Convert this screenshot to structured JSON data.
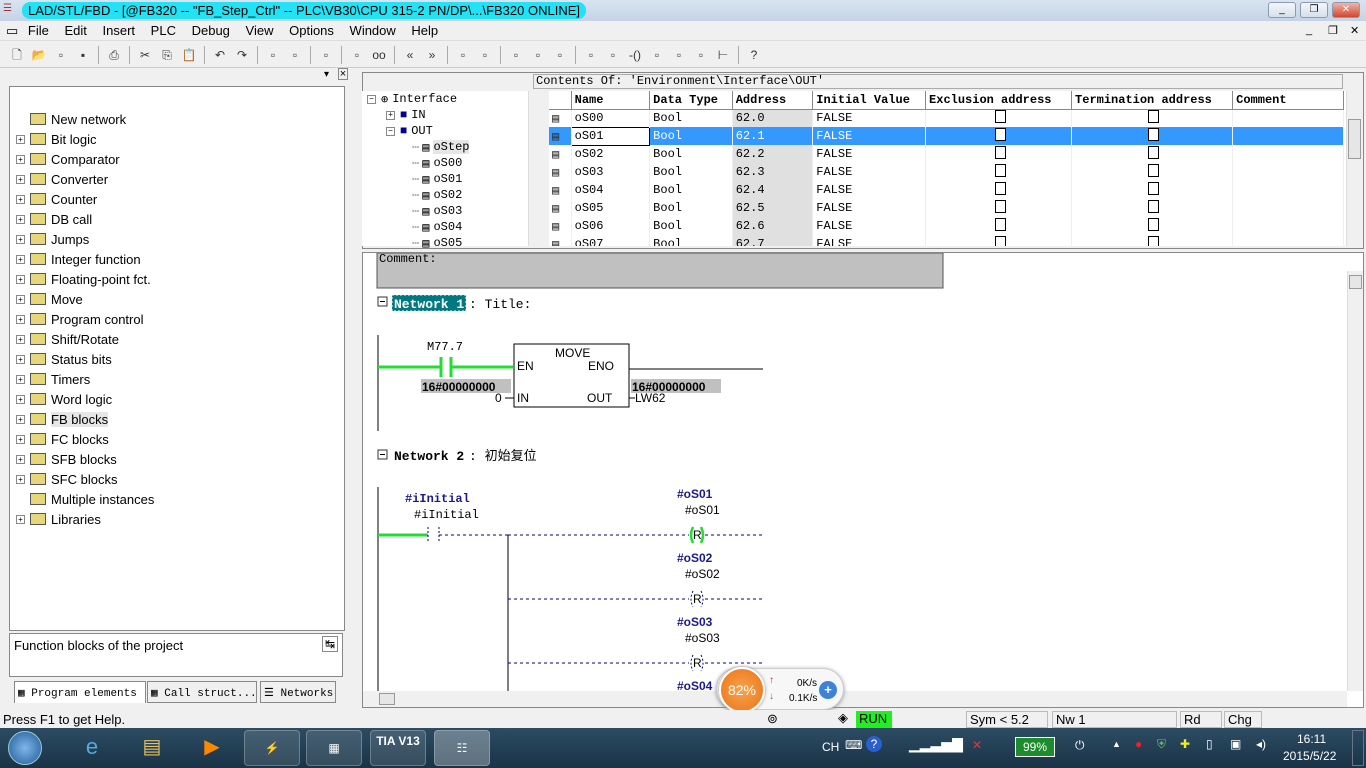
{
  "window": {
    "title": "LAD/STL/FBD  - [@FB320 -- \"FB_Step_Ctrl\" -- PLC\\VB30\\CPU 315-2 PN/DP\\...\\FB320  ONLINE]",
    "controls": [
      "minimize",
      "restore",
      "close"
    ]
  },
  "menu": [
    "File",
    "Edit",
    "Insert",
    "PLC",
    "Debug",
    "View",
    "Options",
    "Window",
    "Help"
  ],
  "toolbar_icons": [
    "new-icon",
    "open-icon",
    "accessible-nodes-icon",
    "save-icon",
    "print-icon",
    "cut-icon",
    "copy-icon",
    "paste-icon",
    "undo-icon",
    "redo-icon",
    "download-icon",
    "upload-icon",
    "monitor-icon",
    "network-icon",
    "glasses-icon",
    "prev-icon",
    "next-icon",
    "overview-icon",
    "details-icon",
    "new-network-icon",
    "branch-icon",
    "close-branch-icon",
    "no-contact-icon",
    "nc-contact-icon",
    "coil-icon",
    "empty-box-icon",
    "open-branch-icon",
    "close-branch-arrow-icon",
    "connect-icon",
    "help-icon"
  ],
  "left": {
    "items": [
      {
        "label": "New network",
        "icon": "new-network-icon",
        "expand": false
      },
      {
        "label": "Bit logic",
        "icon": "bit-logic-icon",
        "expand": true
      },
      {
        "label": "Comparator",
        "icon": "comparator-icon",
        "expand": true
      },
      {
        "label": "Converter",
        "icon": "converter-icon",
        "expand": true
      },
      {
        "label": "Counter",
        "icon": "counter-icon",
        "expand": true
      },
      {
        "label": "DB call",
        "icon": "db-call-icon",
        "expand": true
      },
      {
        "label": "Jumps",
        "icon": "jumps-icon",
        "expand": true
      },
      {
        "label": "Integer function",
        "icon": "integer-icon",
        "expand": true
      },
      {
        "label": "Floating-point fct.",
        "icon": "float-icon",
        "expand": true
      },
      {
        "label": "Move",
        "icon": "move-icon",
        "expand": true
      },
      {
        "label": "Program control",
        "icon": "program-control-icon",
        "expand": true
      },
      {
        "label": "Shift/Rotate",
        "icon": "shift-icon",
        "expand": true
      },
      {
        "label": "Status bits",
        "icon": "status-bits-icon",
        "expand": true
      },
      {
        "label": "Timers",
        "icon": "timers-icon",
        "expand": true
      },
      {
        "label": "Word logic",
        "icon": "word-logic-icon",
        "expand": true
      },
      {
        "label": "FB blocks",
        "icon": "fb-blocks-icon",
        "expand": true,
        "selected": true
      },
      {
        "label": "FC blocks",
        "icon": "fc-blocks-icon",
        "expand": true
      },
      {
        "label": "SFB blocks",
        "icon": "sfb-blocks-icon",
        "expand": true
      },
      {
        "label": "SFC blocks",
        "icon": "sfc-blocks-icon",
        "expand": true
      },
      {
        "label": "Multiple instances",
        "icon": "multi-instance-icon",
        "expand": false
      },
      {
        "label": "Libraries",
        "icon": "libraries-icon",
        "expand": true
      }
    ],
    "info": "Function blocks of the project",
    "tabs": [
      "Program elements",
      "Call struct...",
      "Networks"
    ]
  },
  "interface": {
    "contents": "Contents Of: 'Environment\\Interface\\OUT'",
    "tree": {
      "root": "Interface",
      "in": "IN",
      "out": "OUT",
      "children": [
        "oStep",
        "oS00",
        "oS01",
        "oS02",
        "oS03",
        "oS04",
        "oS05"
      ]
    },
    "columns": [
      "Name",
      "Data Type",
      "Address",
      "Initial Value",
      "Exclusion address",
      "Termination address",
      "Comment"
    ],
    "rows": [
      {
        "name": "oS00",
        "type": "Bool",
        "address": "62.0",
        "initial": "FALSE",
        "exclusion": false,
        "termination": false
      },
      {
        "name": "oS01",
        "type": "Bool",
        "address": "62.1",
        "initial": "FALSE",
        "exclusion": false,
        "termination": false,
        "selected": true
      },
      {
        "name": "oS02",
        "type": "Bool",
        "address": "62.2",
        "initial": "FALSE",
        "exclusion": false,
        "termination": false
      },
      {
        "name": "oS03",
        "type": "Bool",
        "address": "62.3",
        "initial": "FALSE",
        "exclusion": false,
        "termination": false
      },
      {
        "name": "oS04",
        "type": "Bool",
        "address": "62.4",
        "initial": "FALSE",
        "exclusion": false,
        "termination": false
      },
      {
        "name": "oS05",
        "type": "Bool",
        "address": "62.5",
        "initial": "FALSE",
        "exclusion": false,
        "termination": false
      },
      {
        "name": "oS06",
        "type": "Bool",
        "address": "62.6",
        "initial": "FALSE",
        "exclusion": false,
        "termination": false
      },
      {
        "name": "oS07",
        "type": "Bool",
        "address": "62.7",
        "initial": "FALSE",
        "exclusion": false,
        "termination": false
      }
    ]
  },
  "code": {
    "comment": "Comment:",
    "n1": {
      "label": "Network 1",
      "title": ": Title:",
      "contact": "M77.7",
      "box": "MOVE",
      "en": "EN",
      "eno": "ENO",
      "in": "IN",
      "out": "OUT",
      "in_val": "0",
      "in_status": "16#00000000",
      "out_status": "16#00000000",
      "out_addr": "LW62"
    },
    "n2": {
      "label": "Network 2",
      "title": ": 初始复位",
      "contact_sym": "#iInitial",
      "contact": "#iInitial",
      "coils": [
        {
          "sym": "#oS01",
          "addr": "#oS01",
          "op": "R"
        },
        {
          "sym": "#oS02",
          "addr": "#oS02",
          "op": "R"
        },
        {
          "sym": "#oS03",
          "addr": "#oS03",
          "op": "R"
        },
        {
          "sym": "#oS04"
        }
      ]
    }
  },
  "colors": {
    "power_flow": "#22dd33",
    "not_flow": "#000080",
    "selection": "#3399ff",
    "run": "#22ee22"
  },
  "status": {
    "help": "Press F1 to get Help.",
    "mode": "RUN",
    "sym": "Sym < 5.2",
    "nw": "Nw 1",
    "rd": "Rd",
    "chg": "Chg"
  },
  "overlay": {
    "percent": "82%",
    "up": "0K/s",
    "down": "0.1K/s"
  },
  "taskbar": {
    "apps": [
      "start",
      "internet-explorer",
      "file-explorer",
      "media-player",
      "simatic-app",
      "simatic-manager",
      "TIA V13",
      "lad-editor"
    ],
    "tia": "TIA V13",
    "lang": "CH",
    "battery": "99%",
    "time": "16:11",
    "date": "2015/5/22"
  }
}
